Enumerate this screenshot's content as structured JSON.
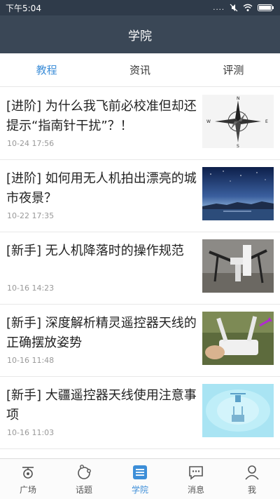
{
  "status_bar": {
    "time": "下午5:04",
    "dots": "...."
  },
  "app_bar": {
    "title": "学院"
  },
  "tabs": [
    {
      "label": "教程",
      "active": true
    },
    {
      "label": "资讯",
      "active": false
    },
    {
      "label": "评测",
      "active": false
    }
  ],
  "articles": [
    {
      "title": "[进阶] 为什么我飞前必校准但却还提示“指南针干扰”？！",
      "time": "10-24 17:56",
      "thumb": "compass-image"
    },
    {
      "title": "[进阶] 如何用无人机拍出漂亮的城市夜景？",
      "time": "10-22 17:35",
      "thumb": "night-city-image"
    },
    {
      "title": "[新手] 无人机降落时的操作规范",
      "time": "10-16 14:23",
      "thumb": "drone-landing-image"
    },
    {
      "title": "[新手] 深度解析精灵遥控器天线的正确摆放姿势",
      "time": "10-16 11:48",
      "thumb": "remote-antenna-image"
    },
    {
      "title": "[新手] 大疆遥控器天线使用注意事项",
      "time": "10-16 11:03",
      "thumb": "antenna-diagram-image"
    }
  ],
  "bottom_nav": [
    {
      "label": "广场",
      "icon": "drone-icon",
      "active": false
    },
    {
      "label": "话题",
      "icon": "topic-icon",
      "active": false
    },
    {
      "label": "学院",
      "icon": "academy-icon",
      "active": true
    },
    {
      "label": "消息",
      "icon": "message-icon",
      "active": false
    },
    {
      "label": "我",
      "icon": "profile-icon",
      "active": false
    }
  ],
  "colors": {
    "accent": "#3d8ed8",
    "header": "#3a4756",
    "status_bar": "#2f3b4a"
  }
}
